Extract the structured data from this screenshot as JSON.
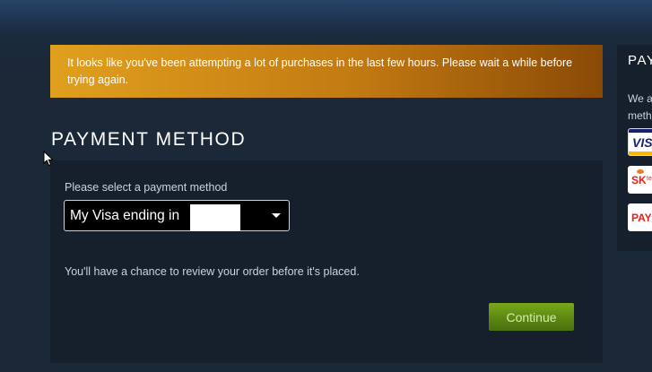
{
  "alert": {
    "message": "It looks like you've been attempting a lot of purchases in the last few hours. Please wait a while before trying again."
  },
  "payment": {
    "title": "PAYMENT METHOD",
    "select_label": "Please select a payment method",
    "selected_value": "My Visa ending in",
    "review_note": "You'll have a chance to review your order before it's placed.",
    "continue_label": "Continue"
  },
  "side": {
    "title_partial": "PAY",
    "text_line1": "We a",
    "text_line2": "meth",
    "logos": [
      {
        "icon": "visa-logo",
        "text": "VISA"
      },
      {
        "icon": "sk-logo",
        "text": "SK",
        "sub": "tele"
      },
      {
        "icon": "payco-logo",
        "text": "PAYCO"
      }
    ]
  },
  "colors": {
    "background": "#1b2838",
    "alert_start": "#e0a01e",
    "alert_end": "#8a4a06",
    "button_green": "#5c8712"
  }
}
